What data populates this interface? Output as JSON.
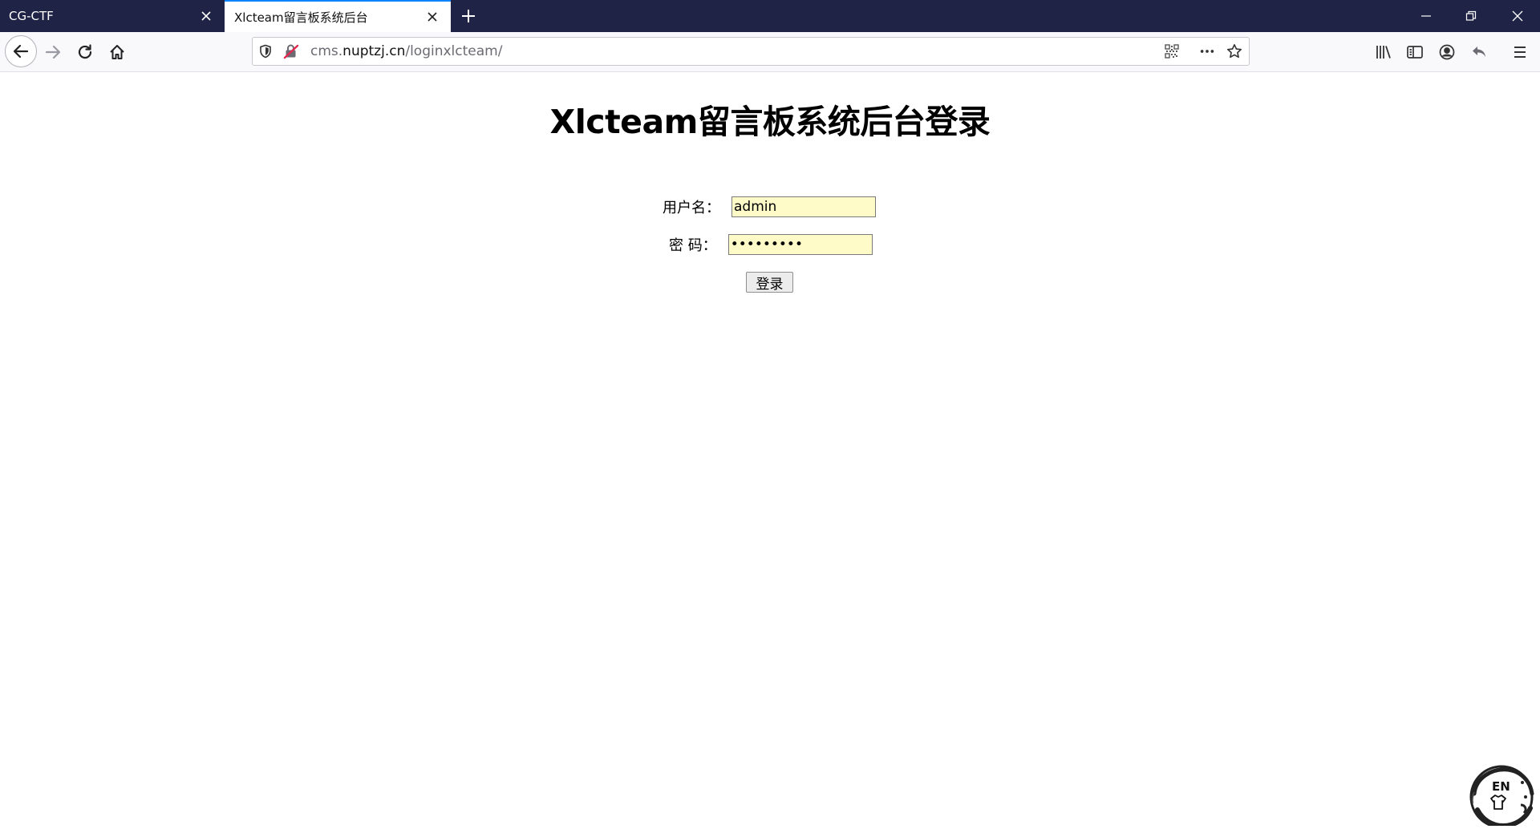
{
  "browser": {
    "tabs": [
      {
        "label": "CG-CTF",
        "active": false
      },
      {
        "label": "Xlcteam留言板系统后台",
        "active": true
      }
    ],
    "url": {
      "prefix": "cms.",
      "domain": "nuptzj.cn",
      "path": "/loginxlcteam/"
    },
    "accent_color": "#0a84ff",
    "titlebar_color": "#1f2446"
  },
  "page": {
    "title": "Xlcteam留言板系统后台登录",
    "form": {
      "username_label": "用户名：",
      "username_value": "admin",
      "password_label": "密 码：",
      "password_value": "123456789",
      "submit_label": "登录",
      "input_bg_color": "#fffbc8"
    }
  },
  "ime": {
    "label": "EN",
    "icon": "shirt-icon"
  }
}
